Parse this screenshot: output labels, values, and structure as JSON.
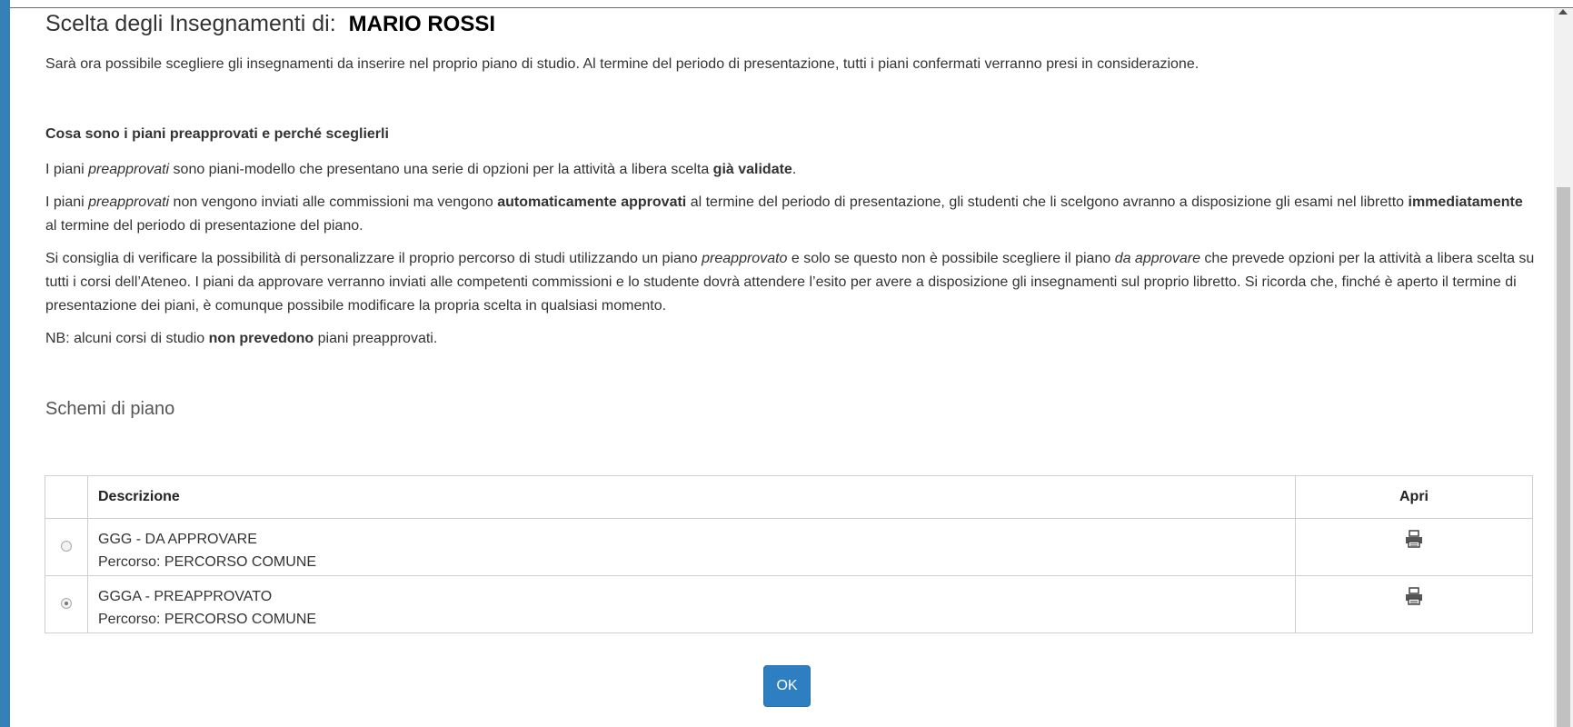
{
  "header": {
    "title": "Scelta degli Insegnamenti di:",
    "student_name": "MARIO ROSSI"
  },
  "intro_text": "Sarà ora possibile scegliere gli insegnamenti da inserire nel proprio piano di studio. Al termine del periodo di presentazione, tutti i piani confermati verranno presi in considerazione.",
  "info": {
    "title": "Cosa sono i piani preapprovati e perché sceglierli",
    "p1": {
      "t1": "I piani ",
      "t2": "preapprovati",
      "t3": " sono piani-modello che presentano una serie di opzioni per la attività a libera scelta ",
      "t4": "già validate",
      "t5": "."
    },
    "p2": {
      "t1": "I piani ",
      "t2": "preapprovati",
      "t3": " non vengono inviati alle commissioni ma vengono ",
      "t4": "automaticamente approvati",
      "t5": " al termine del periodo di presentazione, gli studenti che li scelgono avranno a disposizione gli esami nel libretto ",
      "t6": "immediatamente",
      "t7": " al termine del periodo di presentazione del piano."
    },
    "p3": {
      "t1": "Si consiglia di verificare la possibilità di personalizzare il proprio percorso di studi utilizzando un piano ",
      "t2": "preapprovato",
      "t3": " e solo se questo non è possibile scegliere il piano ",
      "t4": "da approvare",
      "t5": " che prevede opzioni per la attività a libera scelta su tutti i corsi dell’Ateneo. I piani da approvare verranno inviati alle competenti commissioni e lo studente dovrà attendere l’esito per avere a disposizione gli insegnamenti sul proprio libretto. Si ricorda che, finché è aperto il termine di presentazione dei piani, è comunque possibile modificare la propria scelta in qualsiasi momento."
    },
    "p4": {
      "t1": "NB: alcuni corsi di studio ",
      "t2": "non prevedono",
      "t3": " piani preapprovati."
    }
  },
  "schemi": {
    "title": "Schemi di piano",
    "columns": {
      "descrizione": "Descrizione",
      "apri": "Apri"
    },
    "rows": [
      {
        "name": "GGG - DA APPROVARE",
        "percorso": "Percorso: PERCORSO COMUNE",
        "selected": false,
        "icon": "printer-icon"
      },
      {
        "name": "GGGA - PREAPPROVATO",
        "percorso": "Percorso: PERCORSO COMUNE",
        "selected": true,
        "icon": "printer-icon"
      }
    ]
  },
  "ok_label": "OK",
  "colors": {
    "accent": "#2d7fc1",
    "frame": "#3580b9"
  }
}
